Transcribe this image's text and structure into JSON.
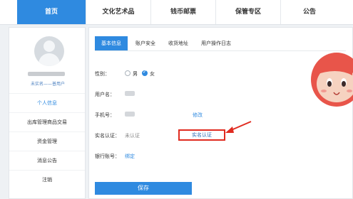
{
  "nav": {
    "items": [
      {
        "label": "首页",
        "active": true
      },
      {
        "label": "文化艺术品",
        "active": false
      },
      {
        "label": "钱币邮票",
        "active": false
      },
      {
        "label": "保管专区",
        "active": false
      },
      {
        "label": "公告",
        "active": false
      }
    ]
  },
  "sidebar": {
    "user_status": "未实名——普用户",
    "menu": [
      {
        "label": "个人信息",
        "active": true
      },
      {
        "label": "出库管理商品交易",
        "active": false
      },
      {
        "label": "资金管理",
        "active": false
      },
      {
        "label": "消息公告",
        "active": false
      },
      {
        "label": "注销",
        "active": false
      }
    ]
  },
  "main": {
    "tabs": [
      {
        "label": "基本信息",
        "active": true
      },
      {
        "label": "账户安全",
        "active": false
      },
      {
        "label": "收货地址",
        "active": false
      },
      {
        "label": "用户操作日志",
        "active": false
      }
    ],
    "gender": {
      "label": "性别：",
      "options": [
        "男",
        "女"
      ],
      "selected": "女"
    },
    "username": {
      "label": "用户名："
    },
    "phone": {
      "label": "手机号：",
      "action": "修改"
    },
    "realname": {
      "label": "实名认证：",
      "status": "未认证",
      "action": "实名认证"
    },
    "bank": {
      "label": "银行账号：",
      "action": "绑定"
    },
    "save_label": "保存"
  },
  "colors": {
    "accent": "#2f8ae0",
    "highlight": "#e02b20"
  }
}
